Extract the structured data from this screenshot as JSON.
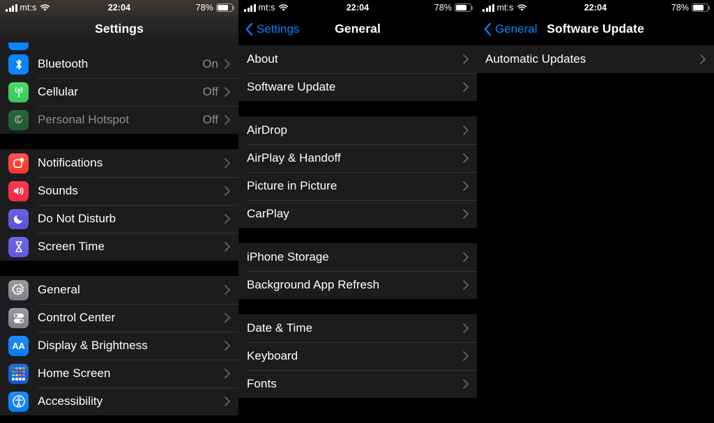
{
  "status_bar": {
    "carrier": "mt:s",
    "time": "22:04",
    "battery_percent": "78%"
  },
  "colors": {
    "accent_blue": "#0a84ff",
    "row_background": "#1c1c1e",
    "page_background": "#000000",
    "separator": "#38383a",
    "secondary_text": "#8e8e93"
  },
  "panels": {
    "settings": {
      "title": "Settings",
      "sections": [
        {
          "rows": [
            {
              "label": "Bluetooth",
              "value": "On",
              "icon": "bluetooth-icon",
              "dim": false
            },
            {
              "label": "Cellular",
              "value": "Off",
              "icon": "cellular-icon",
              "dim": false
            },
            {
              "label": "Personal Hotspot",
              "value": "Off",
              "icon": "hotspot-icon",
              "dim": true
            }
          ]
        },
        {
          "rows": [
            {
              "label": "Notifications",
              "value": "",
              "icon": "notifications-icon",
              "dim": false
            },
            {
              "label": "Sounds",
              "value": "",
              "icon": "sounds-icon",
              "dim": false
            },
            {
              "label": "Do Not Disturb",
              "value": "",
              "icon": "do-not-disturb-icon",
              "dim": false
            },
            {
              "label": "Screen Time",
              "value": "",
              "icon": "screen-time-icon",
              "dim": false
            }
          ]
        },
        {
          "rows": [
            {
              "label": "General",
              "value": "",
              "icon": "general-gear-icon",
              "dim": false
            },
            {
              "label": "Control Center",
              "value": "",
              "icon": "control-center-icon",
              "dim": false
            },
            {
              "label": "Display & Brightness",
              "value": "",
              "icon": "display-brightness-icon",
              "dim": false
            },
            {
              "label": "Home Screen",
              "value": "",
              "icon": "home-screen-icon",
              "dim": false
            },
            {
              "label": "Accessibility",
              "value": "",
              "icon": "accessibility-icon",
              "dim": false
            }
          ]
        }
      ]
    },
    "general": {
      "title": "General",
      "back_label": "Settings",
      "sections": [
        {
          "rows": [
            {
              "label": "About"
            },
            {
              "label": "Software Update"
            }
          ]
        },
        {
          "rows": [
            {
              "label": "AirDrop"
            },
            {
              "label": "AirPlay & Handoff"
            },
            {
              "label": "Picture in Picture"
            },
            {
              "label": "CarPlay"
            }
          ]
        },
        {
          "rows": [
            {
              "label": "iPhone Storage"
            },
            {
              "label": "Background App Refresh"
            }
          ]
        },
        {
          "rows": [
            {
              "label": "Date & Time"
            },
            {
              "label": "Keyboard"
            },
            {
              "label": "Fonts"
            }
          ]
        }
      ]
    },
    "software_update": {
      "title": "Software Update",
      "back_label": "General",
      "sections": [
        {
          "rows": [
            {
              "label": "Automatic Updates"
            }
          ]
        }
      ]
    }
  }
}
